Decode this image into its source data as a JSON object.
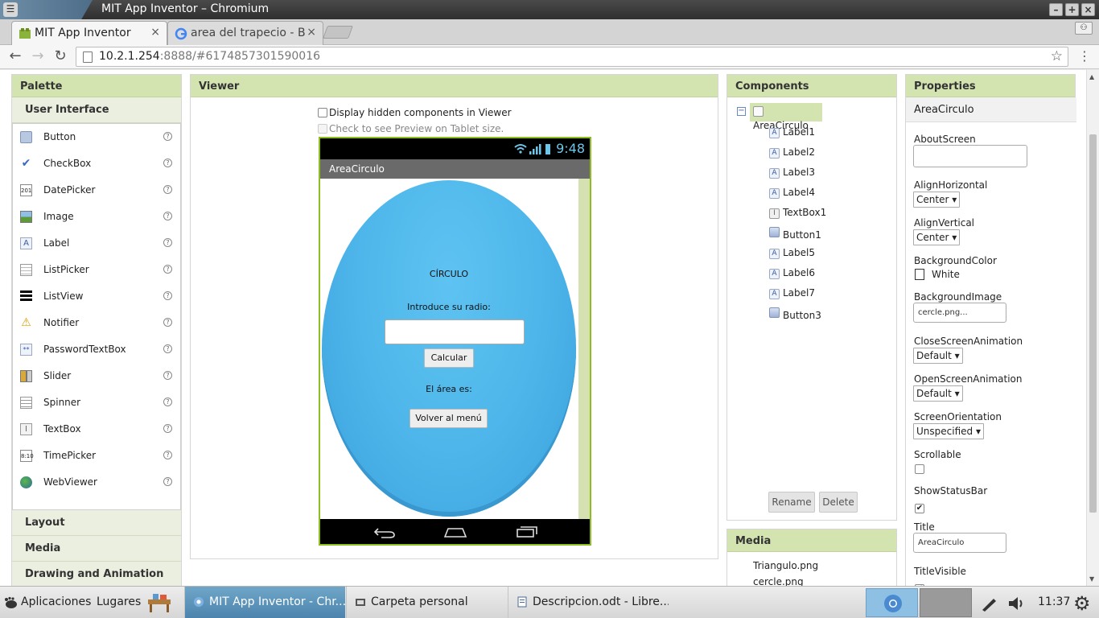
{
  "window": {
    "title": "MIT App Inventor – Chromium"
  },
  "tabs": [
    {
      "label": "MIT App Inventor",
      "close": "×"
    },
    {
      "label": "area del trapecio - B",
      "close": "×"
    }
  ],
  "address": {
    "host": "10.2.1.254",
    "rest": ":8888/#6174857301590016"
  },
  "palette": {
    "header": "Palette",
    "drawer": "User Interface",
    "items": [
      "Button",
      "CheckBox",
      "DatePicker",
      "Image",
      "Label",
      "ListPicker",
      "ListView",
      "Notifier",
      "PasswordTextBox",
      "Slider",
      "Spinner",
      "TextBox",
      "TimePicker",
      "WebViewer"
    ],
    "help": "?",
    "drawers": [
      "Layout",
      "Media",
      "Drawing and Animation"
    ]
  },
  "viewer": {
    "header": "Viewer",
    "hidden_label": "Display hidden components in Viewer",
    "tablet_label": "Check to see Preview on Tablet size.",
    "time": "9:48",
    "app_title": "AreaCirculo",
    "heading": "CÍRCULO",
    "prompt": "Introduce su radio:",
    "calc_button": "Calcular",
    "result_label": "El área es:",
    "back_button": "Volver al menú"
  },
  "components": {
    "header": "Components",
    "root": "AreaCirculo",
    "items": [
      {
        "name": "Label1",
        "icon": "A"
      },
      {
        "name": "Label2",
        "icon": "A"
      },
      {
        "name": "Label3",
        "icon": "A"
      },
      {
        "name": "Label4",
        "icon": "A"
      },
      {
        "name": "TextBox1",
        "icon": "I"
      },
      {
        "name": "Button1",
        "icon": ""
      },
      {
        "name": "Label5",
        "icon": "A"
      },
      {
        "name": "Label6",
        "icon": "A"
      },
      {
        "name": "Label7",
        "icon": "A"
      },
      {
        "name": "Button3",
        "icon": ""
      }
    ],
    "rename": "Rename",
    "delete": "Delete"
  },
  "media": {
    "header": "Media",
    "files": [
      "Triangulo.png",
      "cercle.png"
    ]
  },
  "properties": {
    "header": "Properties",
    "component": "AreaCirculo",
    "about_label": "AboutScreen",
    "align_h_label": "AlignHorizontal",
    "align_h_value": "Center ▾",
    "align_v_label": "AlignVertical",
    "align_v_value": "Center ▾",
    "bg_color_label": "BackgroundColor",
    "bg_color_value": "White",
    "bg_image_label": "BackgroundImage",
    "bg_image_value": "cercle.png...",
    "close_anim_label": "CloseScreenAnimation",
    "close_anim_value": "Default ▾",
    "open_anim_label": "OpenScreenAnimation",
    "open_anim_value": "Default ▾",
    "orientation_label": "ScreenOrientation",
    "orientation_value": "Unspecified ▾",
    "scrollable_label": "Scrollable",
    "status_bar_label": "ShowStatusBar",
    "title_label": "Title",
    "title_value": "AreaCirculo",
    "title_visible_label": "TitleVisible"
  },
  "taskbar": {
    "apps": "Aplicaciones",
    "places": "Lugares",
    "tasks": [
      "MIT App Inventor - Chr...",
      "Carpeta personal",
      "Descripcion.odt - Libre..."
    ],
    "clock": "11:37"
  },
  "colors": {
    "panel_header": "#d4e4b1",
    "phone_border": "#8fbc1e",
    "oval": "#4eb6ea",
    "active_task": "#5a93bb"
  }
}
